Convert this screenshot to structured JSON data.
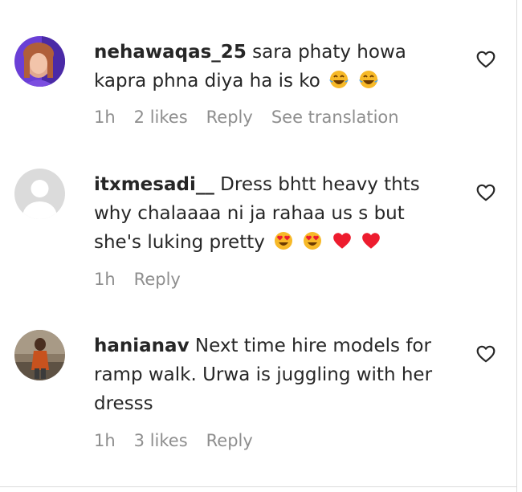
{
  "comments": [
    {
      "username": "nehawaqas_25",
      "text": "sara phaty howa kapra phna diya ha is ko",
      "emojis": [
        "tears-of-joy",
        "tears-of-joy"
      ],
      "time": "1h",
      "likes": "2 likes",
      "reply": "Reply",
      "translate": "See translation"
    },
    {
      "username": "itxmesadi__",
      "text": "Dress bhtt heavy thts why chalaaaa ni ja rahaa us s but she's luking pretty",
      "emojis": [
        "heart-eyes",
        "heart-eyes",
        "red-heart",
        "red-heart"
      ],
      "time": "1h",
      "reply": "Reply"
    },
    {
      "username": "hanianav",
      "text": "Next time hire models for ramp walk. Urwa is juggling with her dresss",
      "time": "1h",
      "likes": "3 likes",
      "reply": "Reply"
    }
  ],
  "colors": {
    "primary_text": "#262626",
    "secondary_text": "#8e8e8e",
    "avatar_purple": "#6a3fd6",
    "emoji_yellow": "#f7b928",
    "heart_red": "#ed1c2e"
  }
}
